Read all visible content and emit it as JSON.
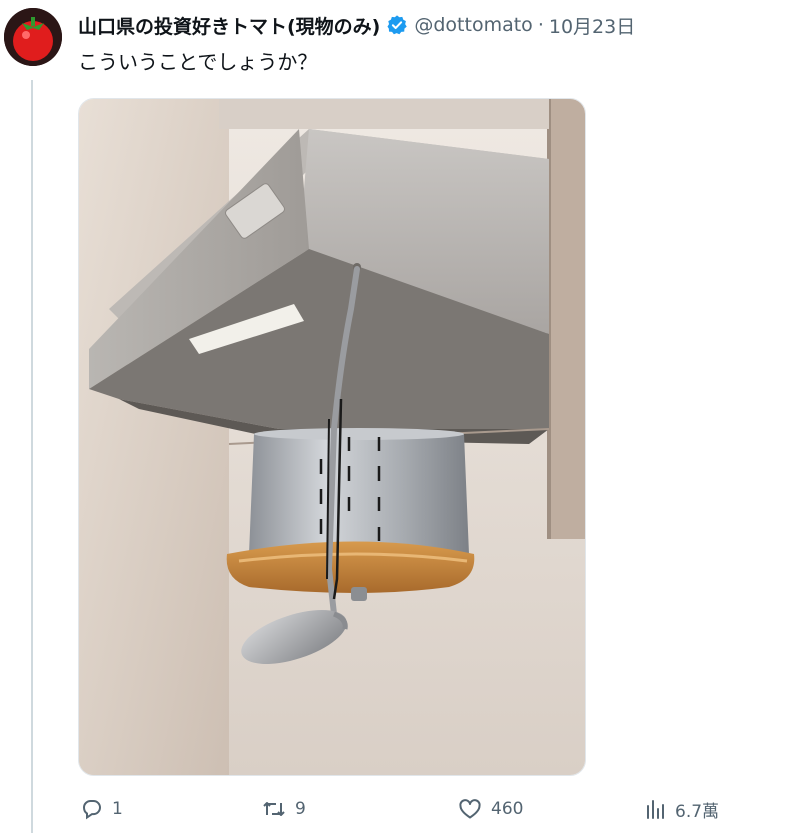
{
  "tweet": {
    "display_name": "山口県の投資好きトマト(現物のみ)",
    "handle": "@dottomato",
    "separator": "·",
    "date": "10月23日",
    "text": "こういうことでしょうか？",
    "verified_color": "#1d9bf0"
  },
  "media": {
    "description_icon": "photo"
  },
  "actions": {
    "reply_count": "1",
    "retweet_count": "9",
    "like_count": "460",
    "views_count": "6.7萬"
  },
  "colors": {
    "text_primary": "#0f1419",
    "text_secondary": "#536471",
    "thread_line": "#cfd9de"
  }
}
